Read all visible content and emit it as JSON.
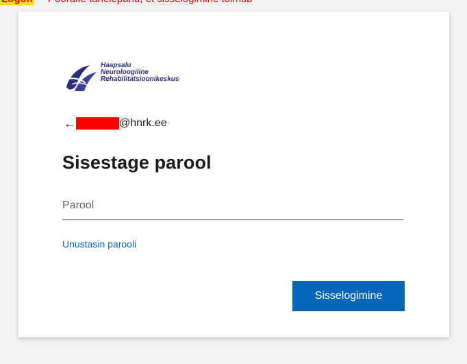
{
  "banner": {
    "label": "Logon",
    "text": "Pöörake tähelepanu, et sisselogimine toimub"
  },
  "logo": {
    "line1": "Haapsalu",
    "line2": "Neuroloogiline",
    "line3": "Rehabilitatsioonikeskus",
    "brand_color": "#2c2f7f"
  },
  "identity": {
    "back_icon": "arrow-left-icon",
    "email_suffix": "@hnrk.ee"
  },
  "page": {
    "heading": "Sisestage parool"
  },
  "form": {
    "password_placeholder": "Parool",
    "forgot_link": "Unustasin parooli",
    "signin_label": "Sisselogimine"
  },
  "colors": {
    "accent": "#0067b8",
    "redaction": "#ff0000",
    "banner_highlight": "#ffe400"
  }
}
